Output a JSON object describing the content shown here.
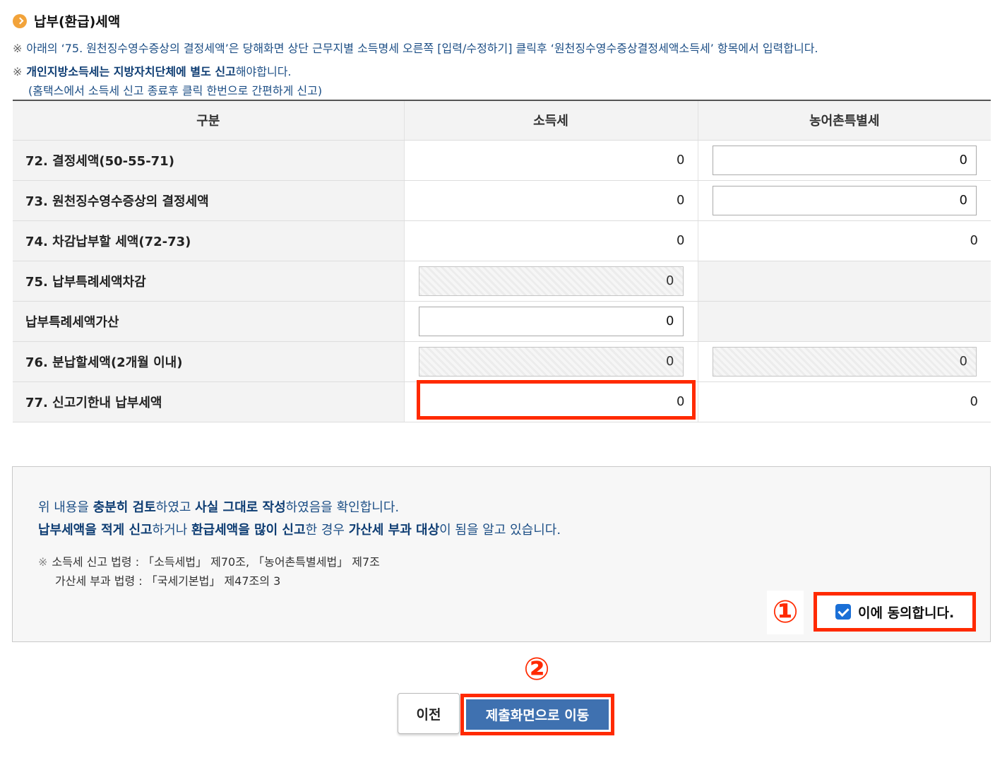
{
  "section": {
    "title": "납부(환급)세액",
    "note1": "아래의 ‘75. 원천징수영수증상의 결정세액’은 당해화면 상단 근무지별 소득명세 오른쪽 [입력/수정하기] 클릭후 ‘원천징수영수증상결정세액소득세’ 항목에서 입력합니다.",
    "note2_bold": "개인지방소득세는 지방자치단체에 별도 신고",
    "note2_rest": "해야합니다.",
    "note3": "(홈택스에서 소득세 신고 종료후 클릭 한번으로 간편하게 신고)",
    "note_mark": "※"
  },
  "table": {
    "headers": [
      "구분",
      "소득세",
      "농어촌특별세"
    ],
    "rows": [
      {
        "label": "72. 결정세액(50-55-71)",
        "income_tax": "0",
        "special_tax": "0"
      },
      {
        "label": "73. 원천징수영수증상의 결정세액",
        "income_tax": "0",
        "special_tax": "0"
      },
      {
        "label": "74. 차감납부할 세액(72-73)",
        "income_tax": "0",
        "special_tax": "0"
      },
      {
        "label": "75. 납부특례세액차감",
        "income_tax": "0",
        "special_tax": ""
      },
      {
        "label": "납부특례세액가산",
        "income_tax": "0",
        "special_tax": ""
      },
      {
        "label": "76. 분납할세액(2개월 이내)",
        "income_tax": "0",
        "special_tax": "0"
      },
      {
        "label": "77. 신고기한내 납부세액",
        "income_tax": "0",
        "special_tax": "0"
      }
    ]
  },
  "confirm": {
    "line1": [
      "위 내용을 ",
      "충분히 검토",
      "하였고 ",
      "사실 그대로 작성",
      "하였음을 확인합니다."
    ],
    "line2": [
      "납부세액을 적게 신고",
      "하거나 ",
      "환급세액을 많이 신고",
      "한 경우 ",
      "가산세 부과 대상",
      "이 됨을 알고 있습니다."
    ],
    "law_mark": "※",
    "law1": "소득세 신고 법령 : 「소득세법」 제70조, 「농어촌특별세법」 제7조",
    "law2": "가산세 부과 법령 : 「국세기본법」 제47조의 3",
    "agree_label": "이에 동의합니다.",
    "agree_checked": true
  },
  "annotations": {
    "step1": "①",
    "step2": "②"
  },
  "buttons": {
    "prev": "이전",
    "submit": "제출화면으로 이동"
  },
  "colors": {
    "accent_text": "#1d4f86",
    "highlight": "#ff2a00",
    "submit_bg": "#3f71b0",
    "title_bullet": "#f2a33a"
  }
}
